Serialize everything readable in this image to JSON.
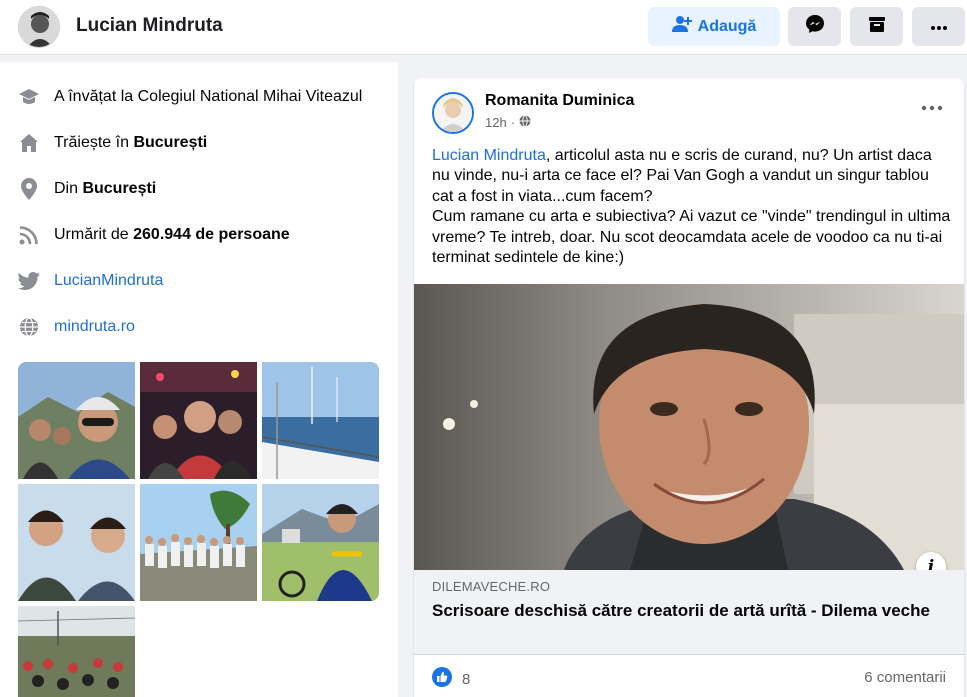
{
  "header": {
    "name": "Lucian Mindruta",
    "add_label": "Adaugă",
    "icons": [
      "add-friend-icon",
      "messenger-icon",
      "save-icon",
      "more-icon"
    ]
  },
  "intro": {
    "education": "A învățat la Colegiul National Mihai Viteazul",
    "lives_prefix": "Trăiește în ",
    "lives_city": "București",
    "from_prefix": "Din ",
    "from_city": "București",
    "followed_prefix": "Urmărit de ",
    "followed_count": "260.944 de persoane",
    "twitter": "LucianMindruta",
    "website": "mindruta.ro"
  },
  "post": {
    "author": "Romanita Duminica",
    "time": "12h",
    "mention": "Lucian Mindruta",
    "text_line1": ", articolul asta nu e scris de curand, nu? Un artist daca nu vinde, nu-i arta ce face el? Pai Van Gogh a vandut un singur tablou cat a fost in viata...cum facem?",
    "text_line2": "Cum ramane cu arta e subiectiva? Ai vazut ce \"vinde\" trendingul in ultima vreme? Te intreb, doar. Nu scot deocamdata acele de voodoo ca nu ti-ai terminat sedintele de kine:)",
    "link_domain": "DILEMAVECHE.RO",
    "link_title": "Scrisoare deschisă către creatorii de artă urîtă - Dilema veche",
    "likes": "8",
    "comments": "6 comentarii"
  },
  "colors": {
    "accent": "#1b74e4",
    "link": "#216fdb",
    "secondary_text": "#65676b",
    "background": "#f0f2f5"
  }
}
